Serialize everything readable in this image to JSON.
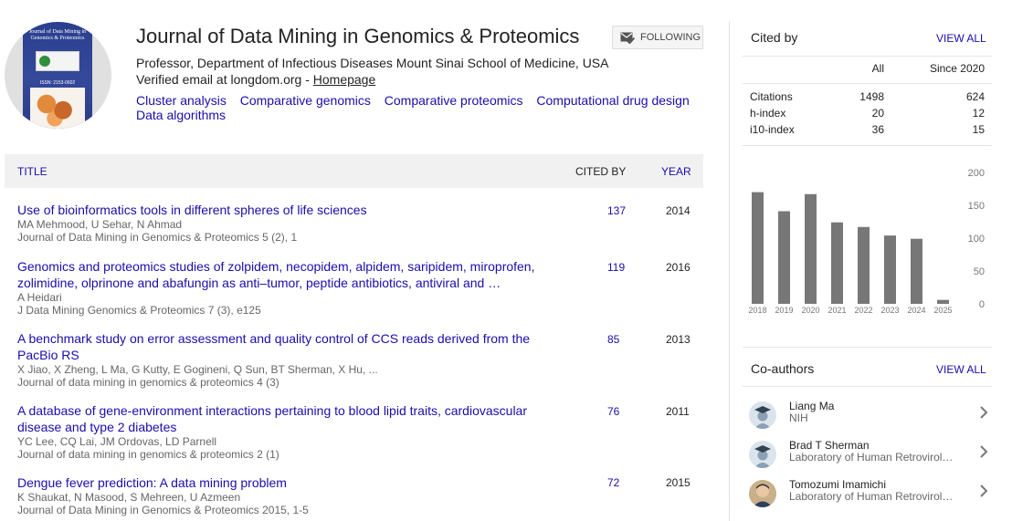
{
  "profile": {
    "name": "Journal of Data Mining in Genomics & Proteomics",
    "affiliation": "Professor, Department of Infectious Diseases Mount Sinai School of Medicine, USA",
    "verified": "Verified email at longdom.org - ",
    "homepage": "Homepage",
    "follow_label": "FOLLOWING",
    "interests": [
      "Cluster analysis",
      "Comparative genomics",
      "Comparative proteomics",
      "Computational drug design",
      "Data algorithms"
    ],
    "cover": {
      "title": "Journal of Data Mining in Genomics & Proteomics",
      "issn": "ISSN: 2153-0602"
    }
  },
  "table": {
    "col_title": "TITLE",
    "col_cited": "CITED BY",
    "col_year": "YEAR",
    "rows": [
      {
        "title": "Use of bioinformatics tools in different spheres of life sciences",
        "authors": "MA Mehmood, U Sehar, N Ahmad",
        "venue": "Journal of Data Mining in Genomics & Proteomics 5 (2), 1",
        "cited": "137",
        "year": "2014"
      },
      {
        "title": "Genomics and proteomics studies of zolpidem, necopidem, alpidem, saripidem, miroprofen, zolimidine, olprinone and abafungin as anti–tumor, peptide antibiotics, antiviral and …",
        "authors": "A Heidari",
        "venue": "J Data Mining Genomics & Proteomics 7 (3), e125",
        "cited": "119",
        "year": "2016"
      },
      {
        "title": "A benchmark study on error assessment and quality control of CCS reads derived from the PacBio RS",
        "authors": "X Jiao, X Zheng, L Ma, G Kutty, E Gogineni, Q Sun, BT Sherman, X Hu, ...",
        "venue": "Journal of data mining in genomics & proteomics 4 (3)",
        "cited": "85",
        "year": "2013"
      },
      {
        "title": "A database of gene-environment interactions pertaining to blood lipid traits, cardiovascular disease and type 2 diabetes",
        "authors": "YC Lee, CQ Lai, JM Ordovas, LD Parnell",
        "venue": "Journal of data mining in genomics & proteomics 2 (1)",
        "cited": "76",
        "year": "2011"
      },
      {
        "title": "Dengue fever prediction: A data mining problem",
        "authors": "K Shaukat, N Masood, S Mehreen, U Azmeen",
        "venue": "Journal of Data Mining in Genomics & Proteomics 2015, 1-5",
        "cited": "72",
        "year": "2015"
      }
    ]
  },
  "cited_by": {
    "title": "Cited by",
    "view_all": "VIEW ALL",
    "col_all": "All",
    "col_since": "Since 2020",
    "rows": [
      {
        "label": "Citations",
        "all": "1498",
        "since": "624"
      },
      {
        "label": "h-index",
        "all": "20",
        "since": "12"
      },
      {
        "label": "i10-index",
        "all": "36",
        "since": "15"
      }
    ]
  },
  "chart_data": {
    "type": "bar",
    "categories": [
      "2018",
      "2019",
      "2020",
      "2021",
      "2022",
      "2023",
      "2024",
      "2025"
    ],
    "values": [
      170,
      141,
      167,
      124,
      117,
      104,
      99,
      6
    ],
    "yticks": [
      0,
      50,
      100,
      150,
      200
    ],
    "ylim": [
      0,
      200
    ],
    "bar_color": "#777777",
    "grid": false
  },
  "coauthors": {
    "title": "Co-authors",
    "view_all": "VIEW ALL",
    "items": [
      {
        "name": "Liang Ma",
        "affiliation": "NIH",
        "avatar": "graduation-cap-placeholder"
      },
      {
        "name": "Brad T Sherman",
        "affiliation": "Laboratory of Human Retrovirolo…",
        "avatar": "graduation-cap-placeholder"
      },
      {
        "name": "Tomozumi Imamichi",
        "affiliation": "Laboratory of Human Retrovirolo…",
        "avatar": "photo"
      }
    ]
  },
  "colors": {
    "link": "#1a0dab",
    "bar": "#777777",
    "header_bg": "#f1f1f1"
  }
}
